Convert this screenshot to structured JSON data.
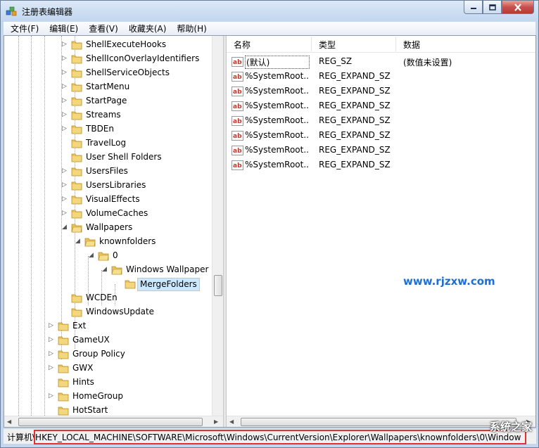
{
  "window": {
    "title": "注册表编辑器"
  },
  "caption": {
    "minimize_icon": "minimize-icon",
    "maximize_icon": "maximize-icon",
    "close_icon": "close-icon"
  },
  "menu": [
    "文件(F)",
    "编辑(E)",
    "查看(V)",
    "收藏夹(A)",
    "帮助(H)"
  ],
  "tree": {
    "rows": [
      {
        "label": "ShellExecuteHooks",
        "expander": "collapsed"
      },
      {
        "label": "ShellIconOverlayIdentifiers",
        "expander": "collapsed"
      },
      {
        "label": "ShellServiceObjects",
        "expander": "collapsed"
      },
      {
        "label": "StartMenu",
        "expander": "collapsed"
      },
      {
        "label": "StartPage",
        "expander": "collapsed"
      },
      {
        "label": "Streams",
        "expander": "collapsed"
      },
      {
        "label": "TBDEn",
        "expander": "collapsed"
      },
      {
        "label": "TravelLog",
        "expander": "none"
      },
      {
        "label": "User Shell Folders",
        "expander": "none"
      },
      {
        "label": "UsersFiles",
        "expander": "collapsed"
      },
      {
        "label": "UsersLibraries",
        "expander": "collapsed"
      },
      {
        "label": "VisualEffects",
        "expander": "collapsed"
      },
      {
        "label": "VolumeCaches",
        "expander": "collapsed"
      },
      {
        "label": "Wallpapers",
        "expander": "expanded"
      },
      {
        "label": "knownfolders",
        "expander": "expanded"
      },
      {
        "label": "0",
        "expander": "expanded"
      },
      {
        "label": "Windows Wallpaper",
        "expander": "expanded"
      },
      {
        "label": "MergeFolders",
        "expander": "none",
        "selected": true
      },
      {
        "label": "WCDEn",
        "expander": "none"
      },
      {
        "label": "WindowsUpdate",
        "expander": "none"
      },
      {
        "label": "Ext",
        "expander": "collapsed"
      },
      {
        "label": "GameUX",
        "expander": "collapsed"
      },
      {
        "label": "Group Policy",
        "expander": "collapsed"
      },
      {
        "label": "GWX",
        "expander": "collapsed"
      },
      {
        "label": "Hints",
        "expander": "none"
      },
      {
        "label": "HomeGroup",
        "expander": "collapsed"
      },
      {
        "label": "HotStart",
        "expander": "none"
      }
    ]
  },
  "list": {
    "columns": [
      "名称",
      "类型",
      "数据"
    ],
    "rows": [
      {
        "name": "(默认)",
        "type": "REG_SZ",
        "data": "(数值未设置)"
      },
      {
        "name": "%SystemRoot...",
        "type": "REG_EXPAND_SZ",
        "data": ""
      },
      {
        "name": "%SystemRoot...",
        "type": "REG_EXPAND_SZ",
        "data": ""
      },
      {
        "name": "%SystemRoot...",
        "type": "REG_EXPAND_SZ",
        "data": ""
      },
      {
        "name": "%SystemRoot...",
        "type": "REG_EXPAND_SZ",
        "data": ""
      },
      {
        "name": "%SystemRoot...",
        "type": "REG_EXPAND_SZ",
        "data": ""
      },
      {
        "name": "%SystemRoot...",
        "type": "REG_EXPAND_SZ",
        "data": ""
      },
      {
        "name": "%SystemRoot...",
        "type": "REG_EXPAND_SZ",
        "data": ""
      }
    ]
  },
  "watermark": "www.rjzxw.com",
  "status": {
    "path": "计算机\\HKEY_LOCAL_MACHINE\\SOFTWARE\\Microsoft\\Windows\\CurrentVersion\\Explorer\\Wallpapers\\knownfolders\\0\\Window",
    "logo": "系统之家"
  },
  "colors": {
    "highlight": "#e03030",
    "folder": "#e8c25a",
    "selection": "#cce8ff"
  }
}
